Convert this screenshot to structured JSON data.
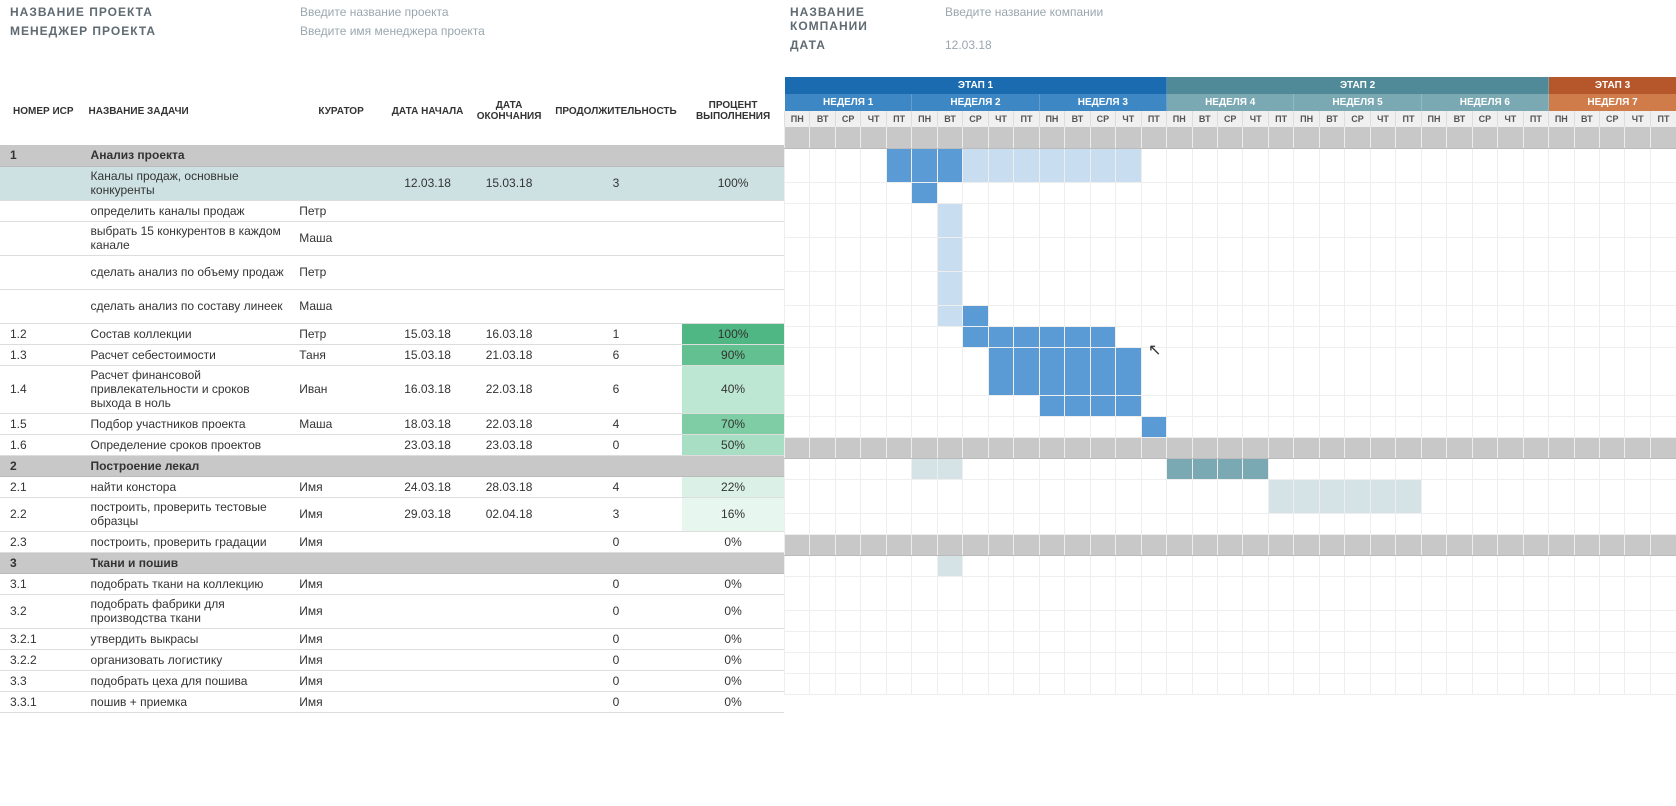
{
  "info": {
    "project_label": "НАЗВАНИЕ ПРОЕКТА",
    "project_ph": "Введите название проекта",
    "manager_label": "МЕНЕДЖЕР ПРОЕКТА",
    "manager_ph": "Введите имя менеджера проекта",
    "company_label": "НАЗВАНИЕ КОМПАНИИ",
    "company_ph": "Введите название компании",
    "date_label": "ДАТА",
    "date_value": "12.03.18"
  },
  "cols": {
    "wbs": "НОМЕР ИСР",
    "task": "НАЗВАНИЕ ЗАДАЧИ",
    "curator": "КУРАТОР",
    "start": "ДАТА НАЧАЛА",
    "end": "ДАТА ОКОНЧАНИЯ",
    "duration": "ПРОДОЛЖИТЕЛЬНОСТЬ",
    "pct": "ПРОЦЕНТ ВЫПОЛНЕНИЯ"
  },
  "phases": [
    "ЭТАП 1",
    "ЭТАП 2",
    "ЭТАП 3"
  ],
  "weeks": [
    "НЕДЕЛЯ 1",
    "НЕДЕЛЯ 2",
    "НЕДЕЛЯ 3",
    "НЕДЕЛЯ 4",
    "НЕДЕЛЯ 5",
    "НЕДЕЛЯ 6",
    "НЕДЕЛЯ 7"
  ],
  "days": [
    "ПН",
    "ВТ",
    "СР",
    "ЧТ",
    "ПТ"
  ],
  "rows": [
    {
      "group": true,
      "wbs": "1",
      "task": "Анализ проекта"
    },
    {
      "sel": true,
      "tall": true,
      "wbs": "",
      "task": "Каналы продаж, основные конкуренты",
      "curator": "",
      "start": "12.03.18",
      "end": "15.03.18",
      "dur": "3",
      "pct": "100%",
      "pclass": "pct-100",
      "bars": [
        [
          4,
          7,
          "blue"
        ],
        [
          7,
          14,
          "blue-l"
        ]
      ]
    },
    {
      "wbs": "",
      "task": "определить каналы продаж",
      "curator": "Петр",
      "bars": [
        [
          5,
          6,
          "blue"
        ]
      ]
    },
    {
      "tall": true,
      "wbs": "",
      "task": "выбрать 15 конкурентов в каждом канале",
      "curator": "Маша",
      "bars": [
        [
          6,
          7,
          "blue-l"
        ]
      ]
    },
    {
      "tall": true,
      "wbs": "",
      "task": "сделать анализ по объему продаж",
      "curator": "Петр",
      "bars": [
        [
          6,
          7,
          "blue-l"
        ]
      ]
    },
    {
      "tall": true,
      "wbs": "",
      "task": "сделать анализ по составу линеек",
      "curator": "Маша",
      "bars": [
        [
          6,
          7,
          "blue-l"
        ]
      ]
    },
    {
      "wbs": "1.2",
      "task": "Состав коллекции",
      "curator": "Петр",
      "start": "15.03.18",
      "end": "16.03.18",
      "dur": "1",
      "pct": "100%",
      "pclass": "pct-100",
      "bars": [
        [
          6,
          8,
          "blue-l"
        ],
        [
          7,
          8,
          "blue"
        ]
      ]
    },
    {
      "wbs": "1.3",
      "task": "Расчет себестоимости",
      "curator": "Таня",
      "start": "15.03.18",
      "end": "21.03.18",
      "dur": "6",
      "pct": "90%",
      "pclass": "pct-90",
      "bars": [
        [
          7,
          13,
          "blue"
        ]
      ]
    },
    {
      "tall3": true,
      "wbs": "1.4",
      "task": "Расчет финансовой привлекательности и сроков выхода в ноль",
      "curator": "Иван",
      "start": "16.03.18",
      "end": "22.03.18",
      "dur": "6",
      "pct": "40%",
      "pclass": "pct-40",
      "bars": [
        [
          8,
          14,
          "blue"
        ]
      ]
    },
    {
      "wbs": "1.5",
      "task": "Подбор участников проекта",
      "curator": "Маша",
      "start": "18.03.18",
      "end": "22.03.18",
      "dur": "4",
      "pct": "70%",
      "pclass": "pct-70",
      "bars": [
        [
          10,
          14,
          "blue"
        ]
      ]
    },
    {
      "wbs": "1.6",
      "task": "Определение сроков проектов",
      "curator": "",
      "start": "23.03.18",
      "end": "23.03.18",
      "dur": "0",
      "pct": "50%",
      "pclass": "pct-50",
      "bars": [
        [
          14,
          15,
          "blue"
        ]
      ]
    },
    {
      "group": true,
      "wbs": "2",
      "task": "Построение лекал"
    },
    {
      "wbs": "2.1",
      "task": "найти констора",
      "curator": "Имя",
      "start": "24.03.18",
      "end": "28.03.18",
      "dur": "4",
      "pct": "22%",
      "pclass": "pct-22",
      "bars": [
        [
          5,
          7,
          "teal-l"
        ],
        [
          15,
          19,
          "teal"
        ]
      ]
    },
    {
      "tall": true,
      "wbs": "2.2",
      "task": "построить, проверить тестовые образцы",
      "curator": "Имя",
      "start": "29.03.18",
      "end": "02.04.18",
      "dur": "3",
      "pct": "16%",
      "pclass": "pct-16",
      "bars": [
        [
          19,
          25,
          "teal-l"
        ]
      ]
    },
    {
      "wbs": "2.3",
      "task": "построить, проверить  градации",
      "curator": "Имя",
      "dur": "0",
      "pct": "0%"
    },
    {
      "group": true,
      "wbs": "3",
      "task": "Ткани и пошив"
    },
    {
      "wbs": "3.1",
      "task": "подобрать ткани на коллекцию",
      "curator": "Имя",
      "dur": "0",
      "pct": "0%",
      "bars": [
        [
          6,
          7,
          "teal-l"
        ]
      ]
    },
    {
      "tall": true,
      "wbs": "3.2",
      "task": "подобрать фабрики для производства ткани",
      "curator": "Имя",
      "dur": "0",
      "pct": "0%"
    },
    {
      "wbs": "3.2.1",
      "task": "утвердить выкрасы",
      "curator": "Имя",
      "dur": "0",
      "pct": "0%"
    },
    {
      "wbs": "3.2.2",
      "task": "организовать логистику",
      "curator": "Имя",
      "dur": "0",
      "pct": "0%"
    },
    {
      "wbs": "3.3",
      "task": "подобрать цеха для пошива",
      "curator": "Имя",
      "dur": "0",
      "pct": "0%"
    },
    {
      "wbs": "3.3.1",
      "task": "пошив + приемка",
      "curator": "Имя",
      "dur": "0",
      "pct": "0%"
    }
  ],
  "chart_data": {
    "type": "gantt",
    "title": "",
    "start_date": "12.03.18",
    "days_per_week": 5,
    "day_labels": [
      "ПН",
      "ВТ",
      "СР",
      "ЧТ",
      "ПТ"
    ],
    "phases": [
      {
        "name": "ЭТАП 1",
        "weeks": [
          "НЕДЕЛЯ 1",
          "НЕДЕЛЯ 2",
          "НЕДЕЛЯ 3"
        ],
        "color": "#1b6bb0"
      },
      {
        "name": "ЭТАП 2",
        "weeks": [
          "НЕДЕЛЯ 4",
          "НЕДЕЛЯ 5",
          "НЕДЕЛЯ 6"
        ],
        "color": "#508a98"
      },
      {
        "name": "ЭТАП 3",
        "weeks": [
          "НЕДЕЛЯ 7"
        ],
        "color": "#b5572a"
      }
    ],
    "tasks": [
      {
        "wbs": "1",
        "name": "Анализ проекта",
        "group": true
      },
      {
        "wbs": "",
        "name": "Каналы продаж, основные конкуренты",
        "curator": "",
        "start": "12.03.18",
        "end": "15.03.18",
        "duration": 3,
        "pct": 100
      },
      {
        "wbs": "",
        "name": "определить каналы продаж",
        "curator": "Петр"
      },
      {
        "wbs": "",
        "name": "выбрать 15 конкурентов в каждом канале",
        "curator": "Маша"
      },
      {
        "wbs": "",
        "name": "сделать анализ по объему продаж",
        "curator": "Петр"
      },
      {
        "wbs": "",
        "name": "сделать анализ по составу линеек",
        "curator": "Маша"
      },
      {
        "wbs": "1.2",
        "name": "Состав коллекции",
        "curator": "Петр",
        "start": "15.03.18",
        "end": "16.03.18",
        "duration": 1,
        "pct": 100
      },
      {
        "wbs": "1.3",
        "name": "Расчет себестоимости",
        "curator": "Таня",
        "start": "15.03.18",
        "end": "21.03.18",
        "duration": 6,
        "pct": 90
      },
      {
        "wbs": "1.4",
        "name": "Расчет финансовой привлекательности и сроков выхода в ноль",
        "curator": "Иван",
        "start": "16.03.18",
        "end": "22.03.18",
        "duration": 6,
        "pct": 40
      },
      {
        "wbs": "1.5",
        "name": "Подбор участников проекта",
        "curator": "Маша",
        "start": "18.03.18",
        "end": "22.03.18",
        "duration": 4,
        "pct": 70
      },
      {
        "wbs": "1.6",
        "name": "Определение сроков проектов",
        "start": "23.03.18",
        "end": "23.03.18",
        "duration": 0,
        "pct": 50
      },
      {
        "wbs": "2",
        "name": "Построение лекал",
        "group": true
      },
      {
        "wbs": "2.1",
        "name": "найти констора",
        "curator": "Имя",
        "start": "24.03.18",
        "end": "28.03.18",
        "duration": 4,
        "pct": 22
      },
      {
        "wbs": "2.2",
        "name": "построить, проверить тестовые образцы",
        "curator": "Имя",
        "start": "29.03.18",
        "end": "02.04.18",
        "duration": 3,
        "pct": 16
      },
      {
        "wbs": "2.3",
        "name": "построить, проверить  градации",
        "curator": "Имя",
        "duration": 0,
        "pct": 0
      },
      {
        "wbs": "3",
        "name": "Ткани и пошив",
        "group": true
      },
      {
        "wbs": "3.1",
        "name": "подобрать ткани на коллекцию",
        "curator": "Имя",
        "duration": 0,
        "pct": 0
      },
      {
        "wbs": "3.2",
        "name": "подобрать фабрики для производства ткани",
        "curator": "Имя",
        "duration": 0,
        "pct": 0
      },
      {
        "wbs": "3.2.1",
        "name": "утвердить выкрасы",
        "curator": "Имя",
        "duration": 0,
        "pct": 0
      },
      {
        "wbs": "3.2.2",
        "name": "организовать логистику",
        "curator": "Имя",
        "duration": 0,
        "pct": 0
      },
      {
        "wbs": "3.3",
        "name": "подобрать цеха для пошива",
        "curator": "Имя",
        "duration": 0,
        "pct": 0
      },
      {
        "wbs": "3.3.1",
        "name": "пошив + приемка",
        "curator": "Имя",
        "duration": 0,
        "pct": 0
      }
    ]
  }
}
